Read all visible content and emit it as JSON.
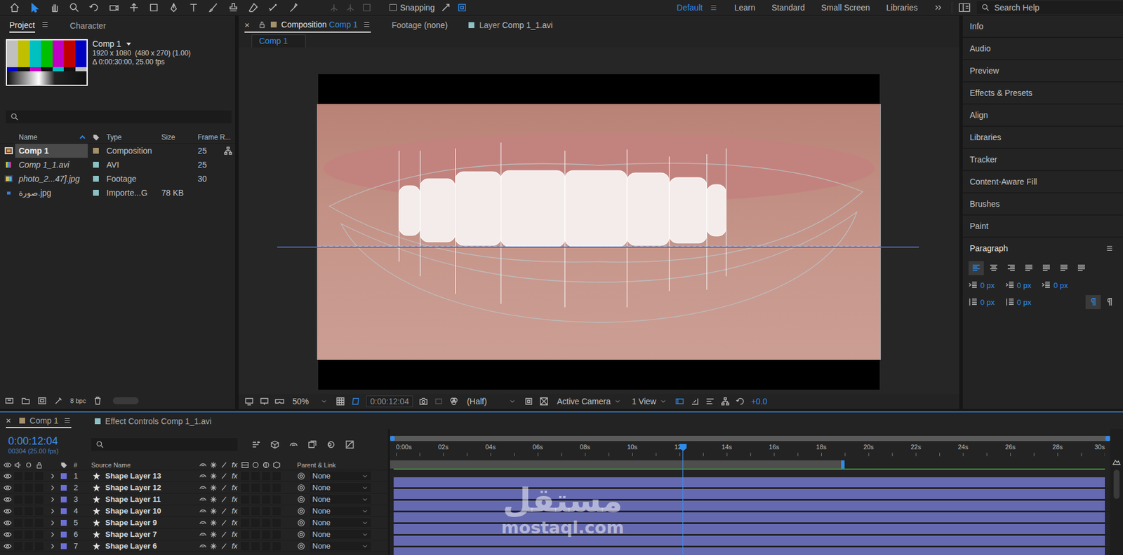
{
  "toolbar": {
    "tools": [
      {
        "selected": false
      },
      {
        "selected": true
      },
      {
        "selected": false
      },
      {
        "selected": false
      },
      {
        "selected": false
      },
      {
        "selected": false
      },
      {
        "selected": false
      },
      {
        "selected": false
      },
      {
        "selected": false
      },
      {
        "selected": false
      },
      {
        "selected": false
      },
      {
        "selected": false
      },
      {
        "selected": false
      },
      {
        "selected": false
      },
      {
        "selected": false
      }
    ],
    "snapping": {
      "label": "Snapping",
      "checked": false
    },
    "workspaces": [
      {
        "label": "Default",
        "selected": true
      },
      {
        "label": "Learn",
        "selected": false
      },
      {
        "label": "Standard",
        "selected": false
      },
      {
        "label": "Small Screen",
        "selected": false
      },
      {
        "label": "Libraries",
        "selected": false
      }
    ],
    "search": {
      "placeholder": "Search Help"
    }
  },
  "project": {
    "tabs": [
      {
        "label": "Project",
        "selected": true
      },
      {
        "label": "Character",
        "selected": false
      }
    ],
    "preview": {
      "title": "Comp 1",
      "details": [
        "1920 x 1080  (480 x 270) (1.00)",
        "Δ 0:00:30:00, 25.00 fps"
      ]
    },
    "columns": {
      "name": "Name",
      "type": "Type",
      "size": "Size",
      "frame_rate": "Frame R..."
    },
    "items": [
      {
        "name": "Comp 1",
        "kind": "composition",
        "type": "Composition",
        "size": "",
        "frame_rate": "25",
        "color": "#a5916a",
        "selected": true
      },
      {
        "name": "Comp 1_1.avi",
        "kind": "video",
        "type": "AVI",
        "size": "",
        "frame_rate": "25",
        "color": "#8cc2c6",
        "selected": false
      },
      {
        "name": "photo_2...47].jpg",
        "kind": "image",
        "type": "Footage",
        "size": "",
        "frame_rate": "30",
        "color": "#8cc2c6",
        "selected": false
      },
      {
        "name": "صورة.jpg",
        "kind": "file",
        "type": "Importe...G",
        "size": "78 KB",
        "frame_rate": "",
        "color": "#8cc2c6",
        "selected": false
      }
    ],
    "footer": {
      "bit_depth": "8 bpc"
    }
  },
  "viewer": {
    "tabs": [
      {
        "label": "Composition",
        "target": "Comp 1",
        "close": "×",
        "locked": true,
        "selected": true
      },
      {
        "label": "Footage",
        "target": "(none)",
        "close": "",
        "locked": false,
        "selected": false
      },
      {
        "label": "Layer",
        "target": "Comp 1_1.avi",
        "close": "",
        "locked": false,
        "selected": false
      }
    ],
    "breadcrumb": "Comp 1",
    "controls": {
      "zoom": "50%",
      "timecode": "0:00:12:04",
      "resolution": "(Half)",
      "camera": "Active Camera",
      "views": "1 View",
      "exposure": "+0.0"
    }
  },
  "side_panels": [
    {
      "label": "Info",
      "expanded": false
    },
    {
      "label": "Audio",
      "expanded": false
    },
    {
      "label": "Preview",
      "expanded": false
    },
    {
      "label": "Effects & Presets",
      "expanded": false
    },
    {
      "label": "Align",
      "expanded": false
    },
    {
      "label": "Libraries",
      "expanded": false
    },
    {
      "label": "Tracker",
      "expanded": false
    },
    {
      "label": "Content-Aware Fill",
      "expanded": false
    },
    {
      "label": "Brushes",
      "expanded": false
    },
    {
      "label": "Paint",
      "expanded": false
    },
    {
      "label": "Paragraph",
      "expanded": true
    }
  ],
  "paragraph": {
    "alignments": [
      {
        "selected": true
      },
      {
        "selected": false
      },
      {
        "selected": false
      },
      {
        "selected": false
      },
      {
        "selected": false
      },
      {
        "selected": false
      },
      {
        "selected": false
      }
    ],
    "values": [
      "0 px",
      "0 px",
      "0 px",
      "0 px",
      "0 px"
    ],
    "directions": [
      {
        "selected": true
      },
      {
        "selected": false
      }
    ]
  },
  "timeline": {
    "tabs": [
      {
        "label": "Comp 1",
        "close": "×",
        "selected": true,
        "color": "#a5916a"
      },
      {
        "label": "Effect Controls Comp 1_1.avi",
        "close": "",
        "selected": false,
        "color": "#8cc2c6"
      }
    ],
    "timecode": "0:00:12:04",
    "frame_info": "00304 (25.00 fps)",
    "columns": {
      "number": "#",
      "source": "Source Name",
      "fx": "fx",
      "parent": "Parent & Link"
    },
    "ruler": [
      "0:00s",
      "02s",
      "04s",
      "06s",
      "08s",
      "10s",
      "12s",
      "14s",
      "16s",
      "18s",
      "20s",
      "22s",
      "24s",
      "26s",
      "28s",
      "30s"
    ],
    "playhead": {
      "level": 0.405
    },
    "work_area": {
      "level": 0.63
    },
    "layers": [
      {
        "number": "1",
        "name": "Shape Layer 13",
        "fx": "fx",
        "parent": "None",
        "visible": true
      },
      {
        "number": "2",
        "name": "Shape Layer 12",
        "fx": "fx",
        "parent": "None",
        "visible": true
      },
      {
        "number": "3",
        "name": "Shape Layer 11",
        "fx": "fx",
        "parent": "None",
        "visible": true
      },
      {
        "number": "4",
        "name": "Shape Layer 10",
        "fx": "fx",
        "parent": "None",
        "visible": true
      },
      {
        "number": "5",
        "name": "Shape Layer 9",
        "fx": "fx",
        "parent": "None",
        "visible": true
      },
      {
        "number": "6",
        "name": "Shape Layer 7",
        "fx": "fx",
        "parent": "None",
        "visible": true
      },
      {
        "number": "7",
        "name": "Shape Layer 6",
        "fx": "fx",
        "parent": "None",
        "visible": true
      }
    ]
  },
  "watermark": {
    "arabic": "مستقل",
    "latin": "mostaql.com"
  }
}
